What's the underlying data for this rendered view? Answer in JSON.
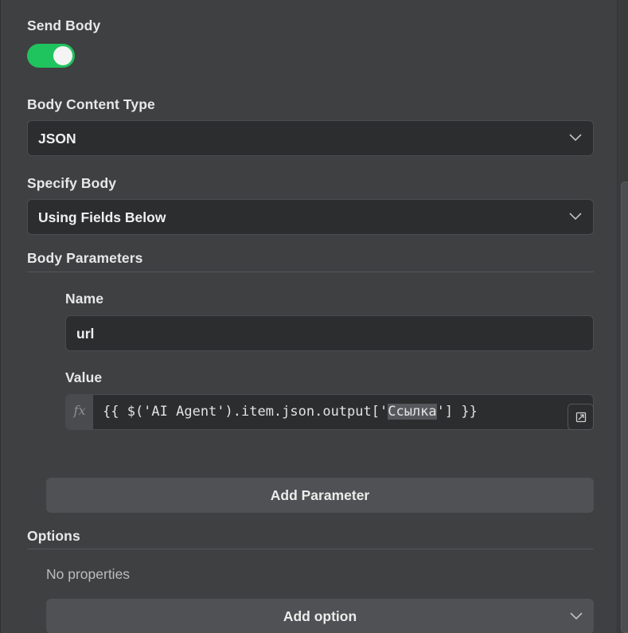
{
  "send_body": {
    "label": "Send Body",
    "enabled": true
  },
  "body_content_type": {
    "label": "Body Content Type",
    "value": "JSON"
  },
  "specify_body": {
    "label": "Specify Body",
    "value": "Using Fields Below"
  },
  "body_parameters": {
    "label": "Body Parameters",
    "name_label": "Name",
    "name_value": "url",
    "value_label": "Value",
    "fx_icon": "fx",
    "expression_prefix": "{{ $('AI Agent').item.json.output['",
    "expression_highlight": "Ссылка",
    "expression_suffix": "'] }}",
    "add_parameter_label": "Add Parameter"
  },
  "options": {
    "label": "Options",
    "empty_text": "No properties",
    "add_option_label": "Add option"
  },
  "colors": {
    "toggle_on": "#1fc45e",
    "panel_bg": "#3f4042",
    "input_bg": "#2c2d2e"
  }
}
